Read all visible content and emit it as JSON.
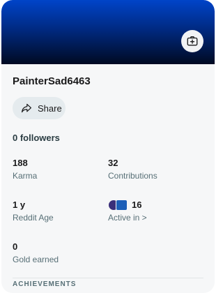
{
  "profile": {
    "username": "PainterSad6463",
    "share_label": "Share",
    "followers_text": "0 followers"
  },
  "stats": [
    {
      "value": "188",
      "label": "Karma"
    },
    {
      "value": "32",
      "label": "Contributions"
    },
    {
      "value": "1 y",
      "label": "Reddit Age"
    },
    {
      "value": "16",
      "label": "Active in >"
    },
    {
      "value": "0",
      "label": "Gold earned"
    }
  ],
  "section_heading": "ACHIEVEMENTS",
  "icons": {
    "banner_action": "add-image-icon",
    "share": "share-arrow-icon"
  },
  "colors": {
    "banner_top": "#0044c9",
    "banner_bottom": "#000a22",
    "card_bg": "#f6f7f8",
    "share_bg": "#e5ebee"
  }
}
